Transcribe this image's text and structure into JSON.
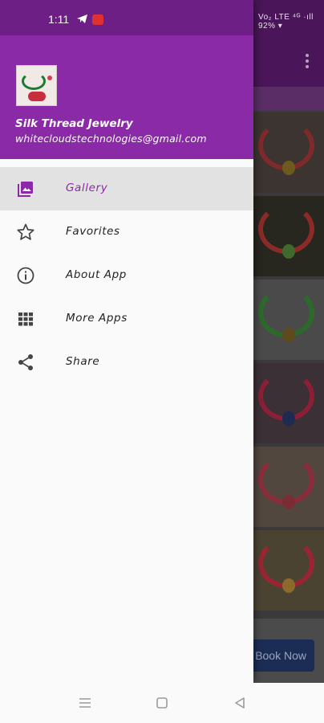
{
  "status_bar": {
    "time": "1:11",
    "right_text": "Vo₂ LTE ⁴ᴳ ·ıll 92% ▾"
  },
  "drawer": {
    "header": {
      "app_name": "Silk Thread Jewelry",
      "email": "whitecloudstechnologies@gmail.com",
      "accent_color": "#8b2aa7"
    },
    "items": [
      {
        "label": "Gallery",
        "icon": "gallery-icon",
        "active": true
      },
      {
        "label": "Favorites",
        "icon": "star-icon",
        "active": false
      },
      {
        "label": "About App",
        "icon": "info-icon",
        "active": false
      },
      {
        "label": "More Apps",
        "icon": "grid-icon",
        "active": false
      },
      {
        "label": "Share",
        "icon": "share-icon",
        "active": false
      }
    ]
  },
  "background": {
    "book_button_label": "Book Now"
  },
  "system_nav": {
    "icons": [
      "recents-icon",
      "home-icon",
      "back-icon"
    ]
  }
}
